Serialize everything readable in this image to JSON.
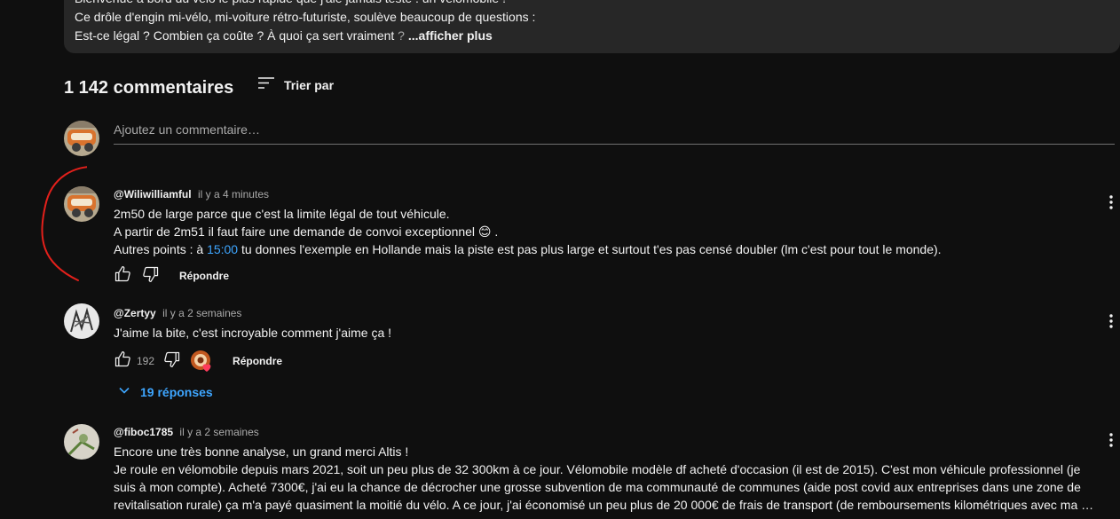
{
  "description": {
    "lines": [
      "Bienvenue à bord du vélo le plus rapide que j'aie jamais testé : un vélomobile !",
      "Ce drôle d'engin mi-vélo, mi-voiture rétro-futuriste, soulève beaucoup de questions :",
      "Est-ce légal ? Combien ça coûte ? À quoi ça sert vraiment"
    ],
    "question_mark": " ?",
    "show_more": "...afficher plus"
  },
  "comments_header": {
    "count_label": "1 142 commentaires",
    "sort_label": "Trier par"
  },
  "add_comment": {
    "placeholder": "Ajoutez un commentaire…"
  },
  "comments": [
    {
      "author": "@Wiliwilliamful",
      "time": "il y a 4 minutes",
      "text_lines": [
        "2m50 de large parce que c'est la limite légal de tout véhicule.",
        "A partir de 2m51 il faut faire une demande de convoi exceptionnel 😊 .",
        "Autres points : à ",
        "15:00",
        " tu donnes l'exemple en Hollande mais la piste est pas plus large et surtout t'es pas censé doubler (lm c'est pour tout le monde)."
      ],
      "likes": "",
      "reply_label": "Répondre"
    },
    {
      "author": "@Zertyy",
      "time": "il y a 2 semaines",
      "text_lines": [
        "J'aime la bite, c'est incroyable comment j'aime ça !"
      ],
      "likes": "192",
      "reply_label": "Répondre",
      "replies_label": "19 réponses"
    },
    {
      "author": "@fiboc1785",
      "time": "il y a 2 semaines",
      "text_lines": [
        "Encore une très bonne analyse, un grand merci Altis !",
        "Je roule en vélomobile depuis mars 2021, soit un peu plus de 32 300km à ce jour. Vélomobile modèle df acheté d'occasion (il est de 2015). C'est mon véhicule professionnel (je",
        "suis à mon compte). Acheté 7300€, j'ai eu la chance de décrocher une grosse subvention de ma communauté de communes (aide post covid aux entreprises dans une zone de",
        "revitalisation rurale) ça m'a payé quasiment la moitié du vélo. A ce jour, j'ai économisé un peu plus de 20 000€ de frais de transport (de remboursements kilométriques avec ma …"
      ]
    }
  ],
  "colors": {
    "background": "#0f0f0f",
    "panel": "#272727",
    "link": "#3ea6ff",
    "annotation": "#e3201b"
  }
}
